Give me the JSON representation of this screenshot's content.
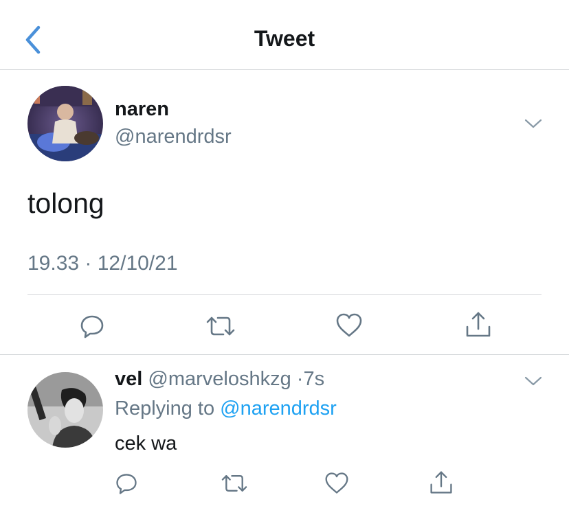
{
  "header": {
    "title": "Tweet"
  },
  "tweet": {
    "display_name": "naren",
    "handle": "@narendrdsr",
    "text": "tolong",
    "timestamp": "19.33 · 12/10/21"
  },
  "reply": {
    "display_name": "vel",
    "handle": "@marveloshkzg",
    "separator": "·",
    "time": "7s",
    "replying_prefix": "Replying to",
    "replying_to": "@narendrdsr",
    "text": "cek wa"
  },
  "icons": {
    "back": "chevron-left-icon",
    "more": "chevron-down-icon",
    "reply": "comment-icon",
    "retweet": "retweet-icon",
    "like": "heart-icon",
    "share": "share-icon"
  },
  "colors": {
    "accent": "#1da1f2",
    "back_arrow": "#4a90d9",
    "text": "#14171a",
    "secondary": "#657786",
    "divider": "#d3d6d9"
  }
}
